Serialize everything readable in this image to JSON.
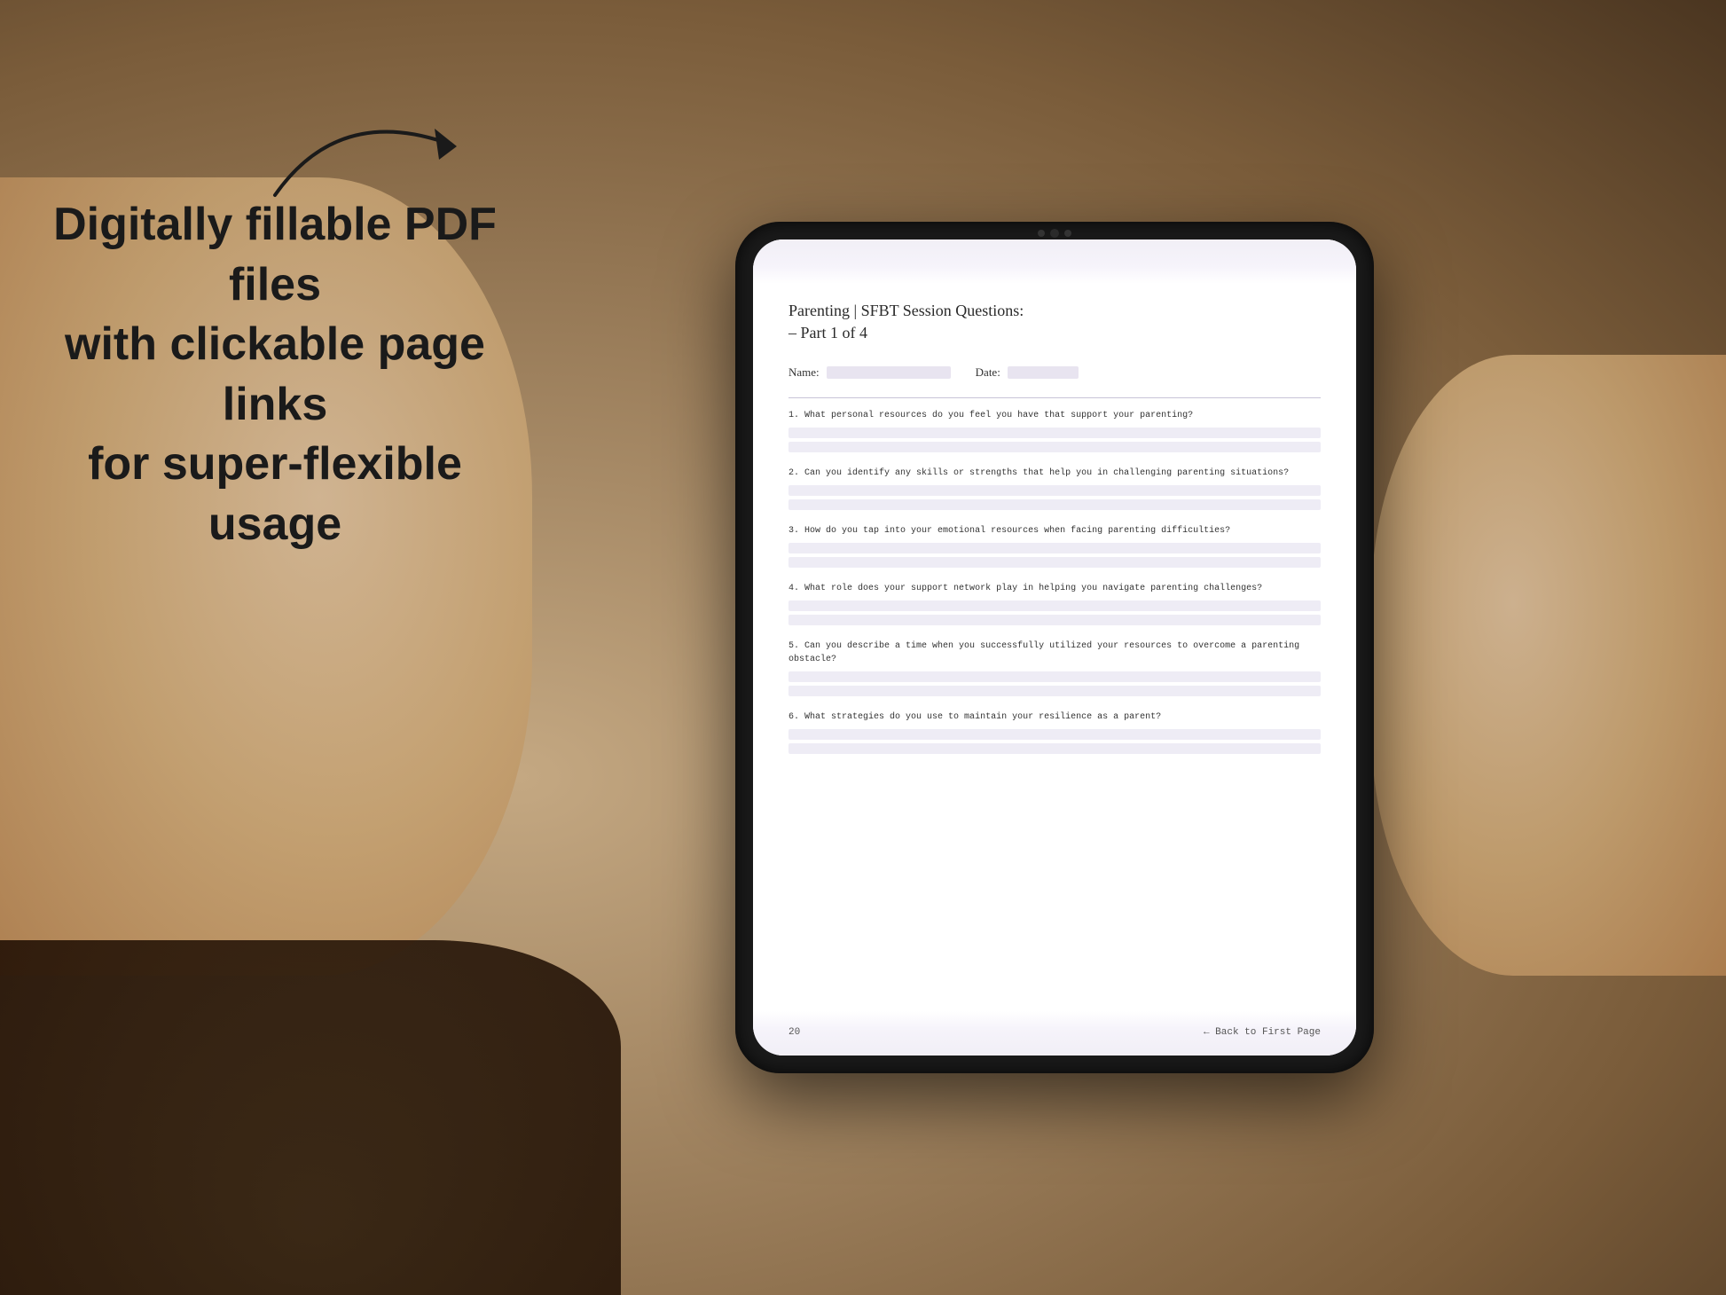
{
  "background": {
    "base_color": "#a89070"
  },
  "left_text": {
    "line1": "Digitally fillable PDF files",
    "line2": "with clickable page links",
    "line3": "for super-flexible usage"
  },
  "arrow": {
    "label": "arrow pointing right"
  },
  "tablet": {
    "camera_label": "front camera"
  },
  "pdf": {
    "title": "Parenting | SFBT Session Questions:",
    "subtitle": "– Part 1 of 4",
    "name_label": "Name:",
    "date_label": "Date:",
    "questions": [
      {
        "number": "1.",
        "text": "What personal resources do you feel you have that support your parenting?",
        "lines": 2
      },
      {
        "number": "2.",
        "text": "Can you identify any skills or strengths that help you in challenging parenting situations?",
        "lines": 2
      },
      {
        "number": "3.",
        "text": "How do you tap into your emotional resources when facing parenting difficulties?",
        "lines": 2
      },
      {
        "number": "4.",
        "text": "What role does your support network play in helping you navigate parenting challenges?",
        "lines": 2
      },
      {
        "number": "5.",
        "text": "Can you describe a time when you successfully utilized your resources to overcome a parenting obstacle?",
        "lines": 2
      },
      {
        "number": "6.",
        "text": "What strategies do you use to maintain your resilience as a parent?",
        "lines": 2
      }
    ],
    "page_number": "20",
    "back_link": "← Back to First Page"
  }
}
